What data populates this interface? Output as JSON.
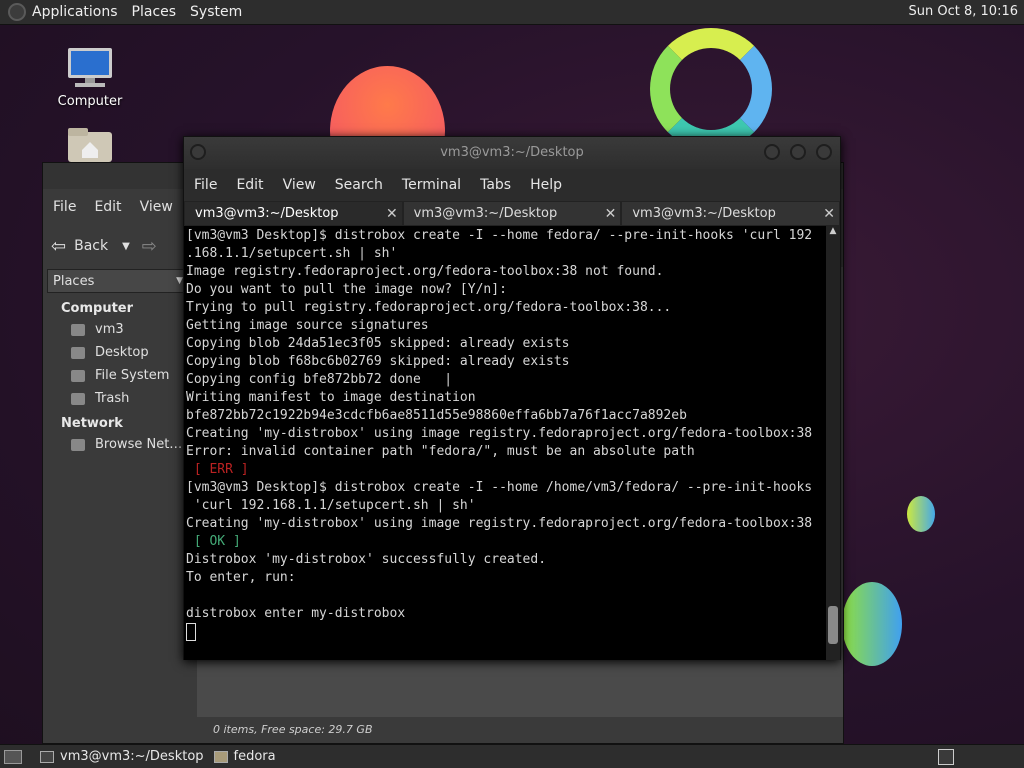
{
  "topbar": {
    "menus": [
      "Applications",
      "Places",
      "System"
    ],
    "clock": "Sun Oct  8, 10:16"
  },
  "desktop": {
    "icons": [
      {
        "label": "Computer",
        "icon": "computer-icon"
      },
      {
        "label": "",
        "icon": "home-folder-icon"
      }
    ]
  },
  "file_manager": {
    "menus": [
      "File",
      "Edit",
      "View"
    ],
    "back_label": "Back",
    "sidebar_header": "Places",
    "sections": [
      {
        "title": "Computer",
        "items": [
          "vm3",
          "Desktop",
          "File System",
          "Trash"
        ]
      },
      {
        "title": "Network",
        "items": [
          "Browse Net…"
        ]
      }
    ],
    "status": "0 items, Free space: 29.7 GB"
  },
  "terminal": {
    "title": "vm3@vm3:~/Desktop",
    "menus": [
      "File",
      "Edit",
      "View",
      "Search",
      "Terminal",
      "Tabs",
      "Help"
    ],
    "tabs": [
      "vm3@vm3:~/Desktop",
      "vm3@vm3:~/Desktop",
      "vm3@vm3:~/Desktop"
    ],
    "lines": [
      {
        "text": "[vm3@vm3 Desktop]$ distrobox create -I --home fedora/ --pre-init-hooks 'curl 192",
        "style": ""
      },
      {
        "text": ".168.1.1/setupcert.sh | sh'",
        "style": ""
      },
      {
        "text": "Image registry.fedoraproject.org/fedora-toolbox:38 not found.",
        "style": ""
      },
      {
        "text": "Do you want to pull the image now? [Y/n]:",
        "style": ""
      },
      {
        "text": "Trying to pull registry.fedoraproject.org/fedora-toolbox:38...",
        "style": ""
      },
      {
        "text": "Getting image source signatures",
        "style": ""
      },
      {
        "text": "Copying blob 24da51ec3f05 skipped: already exists",
        "style": ""
      },
      {
        "text": "Copying blob f68bc6b02769 skipped: already exists",
        "style": ""
      },
      {
        "text": "Copying config bfe872bb72 done   |",
        "style": ""
      },
      {
        "text": "Writing manifest to image destination",
        "style": ""
      },
      {
        "text": "bfe872bb72c1922b94e3cdcfb6ae8511d55e98860effa6bb7a76f1acc7a892eb",
        "style": ""
      },
      {
        "text": "Creating 'my-distrobox' using image registry.fedoraproject.org/fedora-toolbox:38",
        "style": ""
      },
      {
        "text": "Error: invalid container path \"fedora/\", must be an absolute path",
        "style": ""
      },
      {
        "text": " [ ERR ]",
        "style": "err"
      },
      {
        "text": "[vm3@vm3 Desktop]$ distrobox create -I --home /home/vm3/fedora/ --pre-init-hooks",
        "style": ""
      },
      {
        "text": " 'curl 192.168.1.1/setupcert.sh | sh'",
        "style": ""
      },
      {
        "text": "Creating 'my-distrobox' using image registry.fedoraproject.org/fedora-toolbox:38",
        "style": ""
      },
      {
        "text": " [ OK ]",
        "style": "ok"
      },
      {
        "text": "Distrobox 'my-distrobox' successfully created.",
        "style": ""
      },
      {
        "text": "To enter, run:",
        "style": ""
      },
      {
        "text": "",
        "style": ""
      },
      {
        "text": "distrobox enter my-distrobox",
        "style": ""
      },
      {
        "text": "",
        "style": ""
      }
    ]
  },
  "taskbar": {
    "items": [
      {
        "label": "vm3@vm3:~/Desktop",
        "icon": "terminal-icon"
      },
      {
        "label": "fedora",
        "icon": "folder-icon"
      }
    ]
  },
  "colors": {
    "panel_bg": "#2d2d2d",
    "terminal_bg": "#000000",
    "err": "#bb2222",
    "ok": "#44aa77"
  }
}
